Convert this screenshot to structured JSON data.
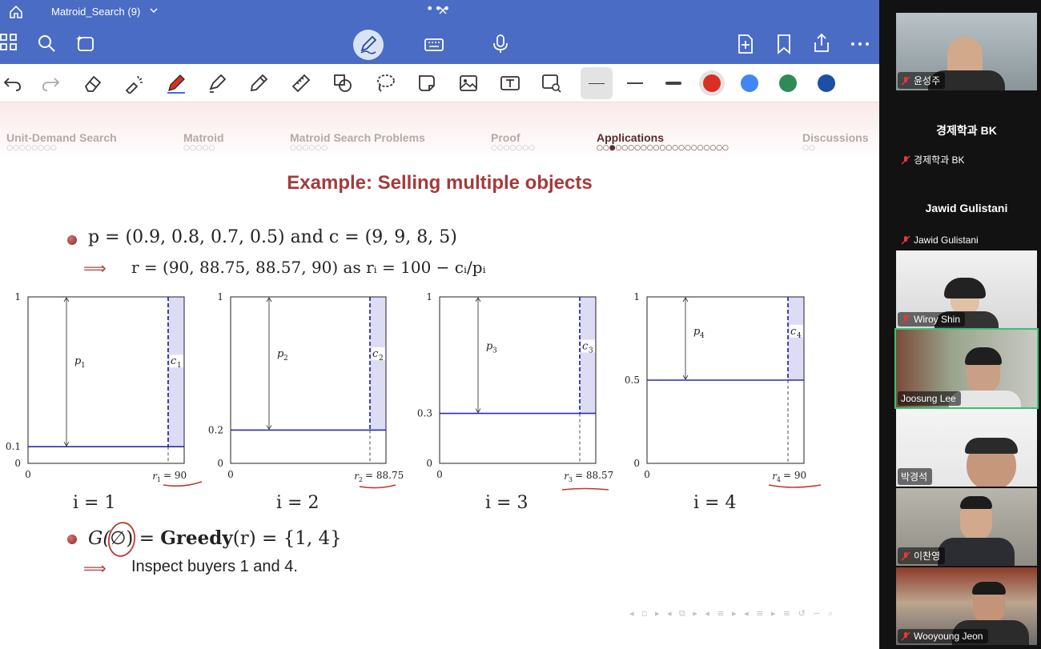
{
  "app": {
    "tab_title": "Matroid_Search (9)",
    "window_dots": "•••"
  },
  "toolbar": {
    "icons": [
      "grid-icon",
      "search-icon",
      "ai-sparkle-icon",
      "pen-mode-icon",
      "keyboard-icon",
      "microphone-icon",
      "add-page-icon",
      "bookmark-icon",
      "share-icon",
      "more-icon"
    ]
  },
  "drawing_tools": {
    "icons": [
      "undo-icon",
      "redo-icon",
      "eraser-icon",
      "laser-pointer-icon",
      "pen-icon",
      "highlighter-icon",
      "pencil-icon",
      "ruler-icon",
      "shapes-icon",
      "lasso-icon",
      "sticker-icon",
      "image-icon",
      "text-box-icon",
      "image-search-icon"
    ],
    "colors": [
      "#d93025",
      "#4285f4",
      "#2e8b57",
      "#1e4fa8"
    ]
  },
  "slide": {
    "nav": [
      {
        "label": "Unit-Demand Search",
        "dots": "○○○○○○○○"
      },
      {
        "label": "Matroid",
        "dots": "○○○○○"
      },
      {
        "label": "Matroid Search Problems",
        "dots": "○○○○○○"
      },
      {
        "label": "Proof",
        "dots": "○○○○○○○"
      },
      {
        "label": "Applications",
        "dots": "○○●○○○○○○○○○○○○○○○○○○"
      },
      {
        "label": "Discussions",
        "dots": "○○"
      }
    ],
    "title": "Example: Selling multiple objects",
    "line1": "p = (0.9, 0.8, 0.7, 0.5) and c = (9, 9, 8, 5)",
    "line2": "r = (90, 88.75, 88.57, 90) as rᵢ = 100 − cᵢ/pᵢ",
    "arrow": "⟹",
    "greedy_pre": "G(",
    "greedy_empty": "∅",
    "greedy_mid": ") = ",
    "greedy_bold": "Greedy",
    "greedy_post": "(r) = {1, 4}",
    "conclusion": "Inspect buyers 1 and 4.",
    "i_labels": [
      "i = 1",
      "i = 2",
      "i = 3",
      "i = 4"
    ],
    "bottom_nav": "◂ ▫ ▸ ◂ ⧉ ▸ ◂ ≡ ▸ ◂ ≡ ▸ ≡ ↺ ∽ ⌕"
  },
  "chart_data": [
    {
      "type": "area",
      "panel": "i = 1",
      "p_label": "p",
      "p_sub": "1",
      "c_label": "c",
      "c_sub": "1",
      "y_threshold": 0.1,
      "y_ticks": [
        "0",
        "0.1",
        "1"
      ],
      "x_ticks": [
        "0"
      ],
      "x_label": "r",
      "x_sub": "1",
      "x_value": "= 90"
    },
    {
      "type": "area",
      "panel": "i = 2",
      "p_label": "p",
      "p_sub": "2",
      "c_label": "c",
      "c_sub": "2",
      "y_threshold": 0.2,
      "y_ticks": [
        "0",
        "0.2",
        "1"
      ],
      "x_ticks": [
        "0"
      ],
      "x_label": "r",
      "x_sub": "2",
      "x_value": "= 88.75"
    },
    {
      "type": "area",
      "panel": "i = 3",
      "p_label": "p",
      "p_sub": "3",
      "c_label": "c",
      "c_sub": "3",
      "y_threshold": 0.3,
      "y_ticks": [
        "0",
        "0.3",
        "1"
      ],
      "x_ticks": [
        "0"
      ],
      "x_label": "r",
      "x_sub": "3",
      "x_value": "= 88.57"
    },
    {
      "type": "area",
      "panel": "i = 4",
      "p_label": "p",
      "p_sub": "4",
      "c_label": "c",
      "c_sub": "4",
      "y_threshold": 0.5,
      "y_ticks": [
        "0",
        "0.5",
        "1"
      ],
      "x_ticks": [
        "0"
      ],
      "x_label": "r",
      "x_sub": "4",
      "x_value": "= 90"
    }
  ],
  "participants": [
    {
      "name": "윤성주",
      "has_video": true
    },
    {
      "name": "경제학과 BK",
      "big_name": "경제학과 BK",
      "has_video": false
    },
    {
      "name": "Jawid Gulistani",
      "big_name": "Jawid Gulistani",
      "has_video": false
    },
    {
      "name": "Wiroy Shin",
      "has_video": true
    },
    {
      "name": "Joosung Lee",
      "has_video": true,
      "speaking": true
    },
    {
      "name": "박경석",
      "has_video": true
    },
    {
      "name": "이찬영",
      "has_video": true
    },
    {
      "name": "Wooyoung Jeon",
      "has_video": true
    }
  ]
}
